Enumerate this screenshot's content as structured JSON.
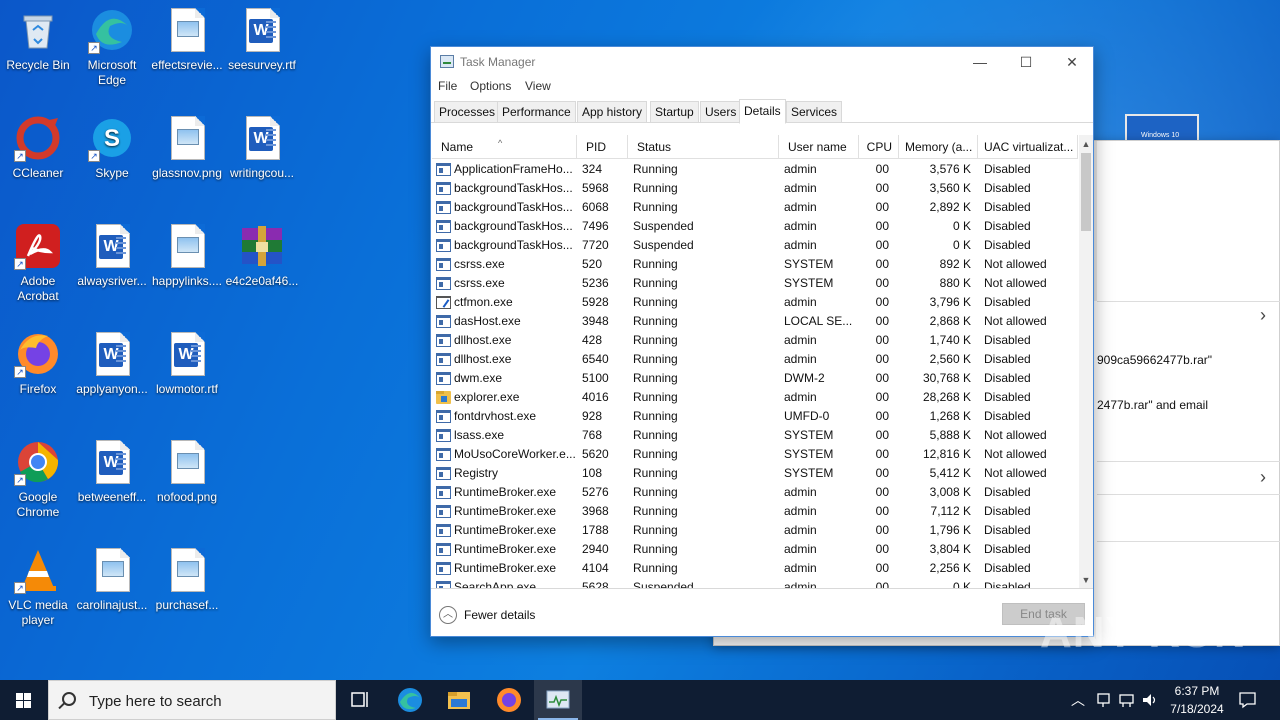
{
  "desktop": {
    "icons": [
      {
        "label": "Recycle Bin",
        "kind": "recycle-bin"
      },
      {
        "label": "Microsoft Edge",
        "kind": "edge"
      },
      {
        "label": "effectsrevie...",
        "kind": "image-file"
      },
      {
        "label": "seesurvey.rtf",
        "kind": "word-file"
      },
      {
        "label": "CCleaner",
        "kind": "ccleaner"
      },
      {
        "label": "Skype",
        "kind": "skype"
      },
      {
        "label": "glassnov.png",
        "kind": "image-file"
      },
      {
        "label": "writingcou...",
        "kind": "word-file"
      },
      {
        "label": "Adobe Acrobat",
        "kind": "acrobat"
      },
      {
        "label": "alwaysriver...",
        "kind": "word-file"
      },
      {
        "label": "happylinks....",
        "kind": "image-file"
      },
      {
        "label": "e4c2e0af46...",
        "kind": "winrar"
      },
      {
        "label": "Firefox",
        "kind": "firefox"
      },
      {
        "label": "applyanyon...",
        "kind": "word-file"
      },
      {
        "label": "lowmotor.rtf",
        "kind": "word-file"
      },
      {
        "label": "Google Chrome",
        "kind": "chrome"
      },
      {
        "label": "betweeneff...",
        "kind": "word-file"
      },
      {
        "label": "nofood.png",
        "kind": "image-file"
      },
      {
        "label": "VLC media player",
        "kind": "vlc"
      },
      {
        "label": "carolinajust...",
        "kind": "image-file"
      },
      {
        "label": "purchasef...",
        "kind": "image-file"
      }
    ]
  },
  "background_window": {
    "text1": "909ca59662477b.rar\"",
    "text2": "2477b.rar\" and email",
    "thumb_label": "Windows 10"
  },
  "task_manager": {
    "title": "Task Manager",
    "controls": {
      "minimize": "—",
      "maximize": "☐",
      "close": "✕"
    },
    "menu": [
      "File",
      "Options",
      "View"
    ],
    "tabs": [
      "Processes",
      "Performance",
      "App history",
      "Startup",
      "Users",
      "Details",
      "Services"
    ],
    "active_tab": "Details",
    "columns": [
      "Name",
      "PID",
      "Status",
      "User name",
      "CPU",
      "Memory (a...",
      "UAC virtualizat..."
    ],
    "rows": [
      {
        "name": "ApplicationFrameHo...",
        "pid": "324",
        "status": "Running",
        "user": "admin",
        "cpu": "00",
        "mem": "3,576 K",
        "uac": "Disabled",
        "icon": "app"
      },
      {
        "name": "backgroundTaskHos...",
        "pid": "5968",
        "status": "Running",
        "user": "admin",
        "cpu": "00",
        "mem": "3,560 K",
        "uac": "Disabled",
        "icon": "app"
      },
      {
        "name": "backgroundTaskHos...",
        "pid": "6068",
        "status": "Running",
        "user": "admin",
        "cpu": "00",
        "mem": "2,892 K",
        "uac": "Disabled",
        "icon": "app"
      },
      {
        "name": "backgroundTaskHos...",
        "pid": "7496",
        "status": "Suspended",
        "user": "admin",
        "cpu": "00",
        "mem": "0 K",
        "uac": "Disabled",
        "icon": "app"
      },
      {
        "name": "backgroundTaskHos...",
        "pid": "7720",
        "status": "Suspended",
        "user": "admin",
        "cpu": "00",
        "mem": "0 K",
        "uac": "Disabled",
        "icon": "app"
      },
      {
        "name": "csrss.exe",
        "pid": "520",
        "status": "Running",
        "user": "SYSTEM",
        "cpu": "00",
        "mem": "892 K",
        "uac": "Not allowed",
        "icon": "app"
      },
      {
        "name": "csrss.exe",
        "pid": "5236",
        "status": "Running",
        "user": "SYSTEM",
        "cpu": "00",
        "mem": "880 K",
        "uac": "Not allowed",
        "icon": "app"
      },
      {
        "name": "ctfmon.exe",
        "pid": "5928",
        "status": "Running",
        "user": "admin",
        "cpu": "00",
        "mem": "3,796 K",
        "uac": "Disabled",
        "icon": "pen"
      },
      {
        "name": "dasHost.exe",
        "pid": "3948",
        "status": "Running",
        "user": "LOCAL SE...",
        "cpu": "00",
        "mem": "2,868 K",
        "uac": "Not allowed",
        "icon": "app"
      },
      {
        "name": "dllhost.exe",
        "pid": "428",
        "status": "Running",
        "user": "admin",
        "cpu": "00",
        "mem": "1,740 K",
        "uac": "Disabled",
        "icon": "app"
      },
      {
        "name": "dllhost.exe",
        "pid": "6540",
        "status": "Running",
        "user": "admin",
        "cpu": "00",
        "mem": "2,560 K",
        "uac": "Disabled",
        "icon": "app"
      },
      {
        "name": "dwm.exe",
        "pid": "5100",
        "status": "Running",
        "user": "DWM-2",
        "cpu": "00",
        "mem": "30,768 K",
        "uac": "Disabled",
        "icon": "app"
      },
      {
        "name": "explorer.exe",
        "pid": "4016",
        "status": "Running",
        "user": "admin",
        "cpu": "00",
        "mem": "28,268 K",
        "uac": "Disabled",
        "icon": "folder"
      },
      {
        "name": "fontdrvhost.exe",
        "pid": "928",
        "status": "Running",
        "user": "UMFD-0",
        "cpu": "00",
        "mem": "1,268 K",
        "uac": "Disabled",
        "icon": "app"
      },
      {
        "name": "lsass.exe",
        "pid": "768",
        "status": "Running",
        "user": "SYSTEM",
        "cpu": "00",
        "mem": "5,888 K",
        "uac": "Not allowed",
        "icon": "app"
      },
      {
        "name": "MoUsoCoreWorker.e...",
        "pid": "5620",
        "status": "Running",
        "user": "SYSTEM",
        "cpu": "00",
        "mem": "12,816 K",
        "uac": "Not allowed",
        "icon": "app"
      },
      {
        "name": "Registry",
        "pid": "108",
        "status": "Running",
        "user": "SYSTEM",
        "cpu": "00",
        "mem": "5,412 K",
        "uac": "Not allowed",
        "icon": "app"
      },
      {
        "name": "RuntimeBroker.exe",
        "pid": "5276",
        "status": "Running",
        "user": "admin",
        "cpu": "00",
        "mem": "3,008 K",
        "uac": "Disabled",
        "icon": "app"
      },
      {
        "name": "RuntimeBroker.exe",
        "pid": "3968",
        "status": "Running",
        "user": "admin",
        "cpu": "00",
        "mem": "7,112 K",
        "uac": "Disabled",
        "icon": "app"
      },
      {
        "name": "RuntimeBroker.exe",
        "pid": "1788",
        "status": "Running",
        "user": "admin",
        "cpu": "00",
        "mem": "1,796 K",
        "uac": "Disabled",
        "icon": "app"
      },
      {
        "name": "RuntimeBroker.exe",
        "pid": "2940",
        "status": "Running",
        "user": "admin",
        "cpu": "00",
        "mem": "3,804 K",
        "uac": "Disabled",
        "icon": "app"
      },
      {
        "name": "RuntimeBroker.exe",
        "pid": "4104",
        "status": "Running",
        "user": "admin",
        "cpu": "00",
        "mem": "2,256 K",
        "uac": "Disabled",
        "icon": "app"
      },
      {
        "name": "SearchApp.exe",
        "pid": "5628",
        "status": "Suspended",
        "user": "admin",
        "cpu": "00",
        "mem": "0 K",
        "uac": "Disabled",
        "icon": "app"
      }
    ],
    "footer": {
      "fewer_details": "Fewer details",
      "end_task": "End task"
    }
  },
  "watermark": "ANY RUN",
  "taskbar": {
    "search_placeholder": "Type here to search",
    "time": "6:37 PM",
    "date": "7/18/2024"
  }
}
